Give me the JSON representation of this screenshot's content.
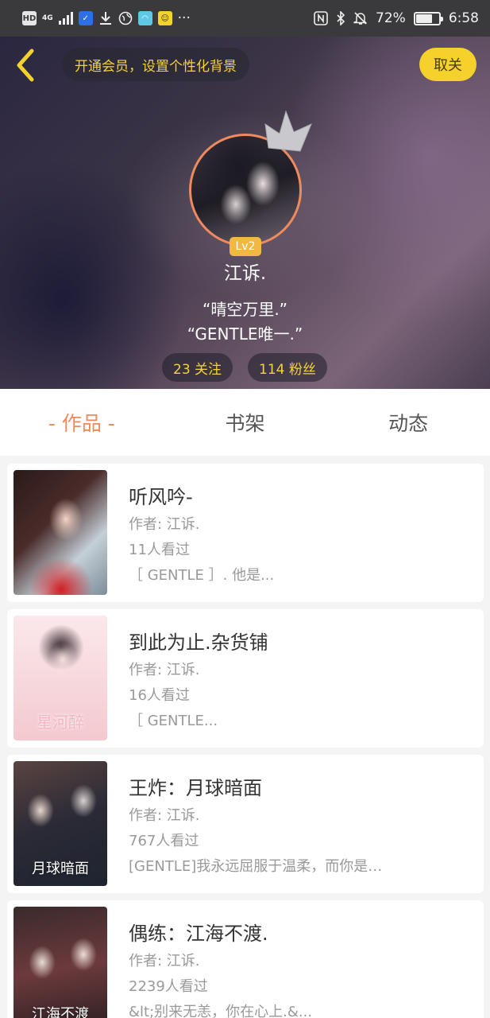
{
  "status_bar": {
    "net_label": "4G",
    "battery": "72%",
    "battery_level": 0.72,
    "time": "6:58",
    "more": "···"
  },
  "header": {
    "vip_text": "开通会员，设置个性化背景",
    "follow_label": "取关",
    "level": "Lv2",
    "username": "江诉.",
    "bio_line1": "“晴空万里.”",
    "bio_line2": "“GENTLE唯一.”",
    "following": "23 关注",
    "followers": "114 粉丝"
  },
  "tabs": [
    {
      "label": "- 作品 -"
    },
    {
      "label": "书架"
    },
    {
      "label": "动态"
    }
  ],
  "works": [
    {
      "title": "听风吟-",
      "author": "作者: 江诉.",
      "views": "11人看过",
      "desc": "［ GENTLE ］. 他是...",
      "cover_text": ""
    },
    {
      "title": "到此为止.杂货铺",
      "author": "作者: 江诉.",
      "views": "16人看过",
      "desc": "［ GENTLE...",
      "cover_text": "星河醉"
    },
    {
      "title": "王炸：月球暗面",
      "author": "作者: 江诉.",
      "views": "767人看过",
      "desc": "[GENTLE]我永远屈服于温柔，而你是…",
      "cover_text": "月球暗面"
    },
    {
      "title": "偶练：江海不渡.",
      "author": "作者: 江诉.",
      "views": "2239人看过",
      "desc": "&lt;别来无恙，你在心上.&...",
      "cover_text": "江海不渡"
    }
  ]
}
